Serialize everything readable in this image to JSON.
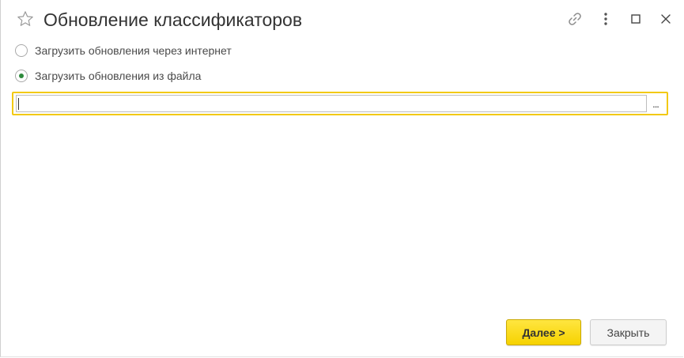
{
  "header": {
    "title": "Обновление классификаторов",
    "favorite_icon": "star-icon",
    "link_icon": "link-icon",
    "more_icon": "more-vertical-icon",
    "maximize_icon": "maximize-icon",
    "close_icon": "close-icon"
  },
  "options": [
    {
      "label": "Загрузить обновления через интернет",
      "selected": false
    },
    {
      "label": "Загрузить обновления из файла",
      "selected": true
    }
  ],
  "file_field": {
    "value": "",
    "choose_label": "..."
  },
  "footer": {
    "next_label": "Далее >",
    "close_label": "Закрыть"
  },
  "colors": {
    "accent": "#f2c912",
    "primary_button": "#f6d200",
    "radio_selected": "#2e8b3d"
  }
}
